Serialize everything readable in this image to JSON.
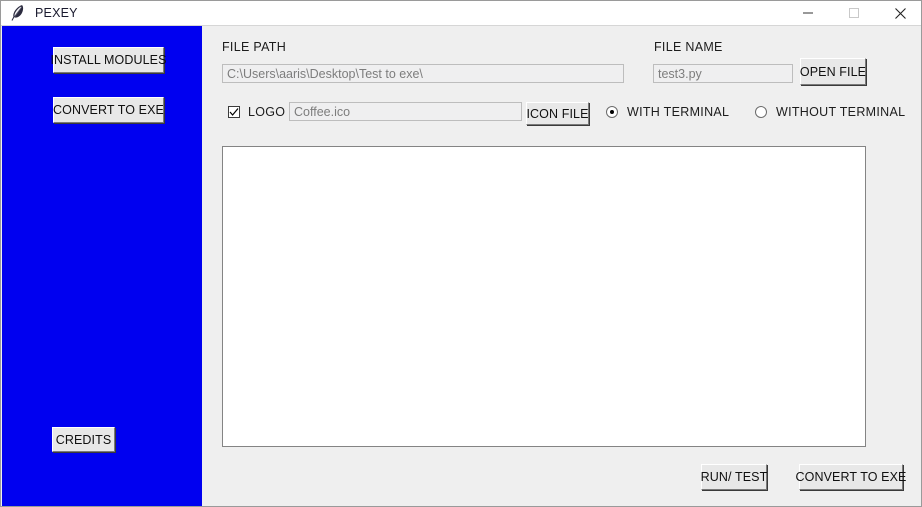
{
  "window": {
    "title": "PEXEY",
    "icon": "feather-icon",
    "caption": {
      "minimize": "minimize-icon",
      "maximize": "maximize-icon",
      "close": "close-icon"
    }
  },
  "colors": {
    "sidebar": "#0000f0",
    "panel": "#efefef",
    "button_face": "#e8e8e8",
    "text": "#1d1d1d",
    "entry_placeholder": "#7d7d7d"
  },
  "sidebar": {
    "buttons": [
      {
        "label": "INSTALL MODULES"
      },
      {
        "label": "CONVERT TO EXE"
      },
      {
        "label": "CREDITS"
      }
    ]
  },
  "form": {
    "file_path": {
      "label": "FILE PATH",
      "value": "C:\\Users\\aaris\\Desktop\\Test to exe\\",
      "placeholder": "C:\\Users\\aaris\\Desktop\\Test to exe\\"
    },
    "file_name": {
      "label": "FILE NAME",
      "value": "test3.py",
      "placeholder": "test3.py"
    },
    "open_file_button": "OPEN FILE",
    "logo": {
      "label": "LOGO",
      "checked": true,
      "icon": "checkmark-icon"
    },
    "icon_file": {
      "value": "Coffee.ico",
      "placeholder": "Coffee.ico",
      "button": "ICON FILE"
    },
    "terminal_mode": {
      "options": [
        {
          "label": "WITH TERMINAL",
          "selected": true
        },
        {
          "label": "WITHOUT TERMINAL",
          "selected": false
        }
      ]
    }
  },
  "output": {
    "text": ""
  },
  "actions": {
    "run_test": "RUN/ TEST",
    "convert_to_exe": "CONVERT TO EXE"
  }
}
